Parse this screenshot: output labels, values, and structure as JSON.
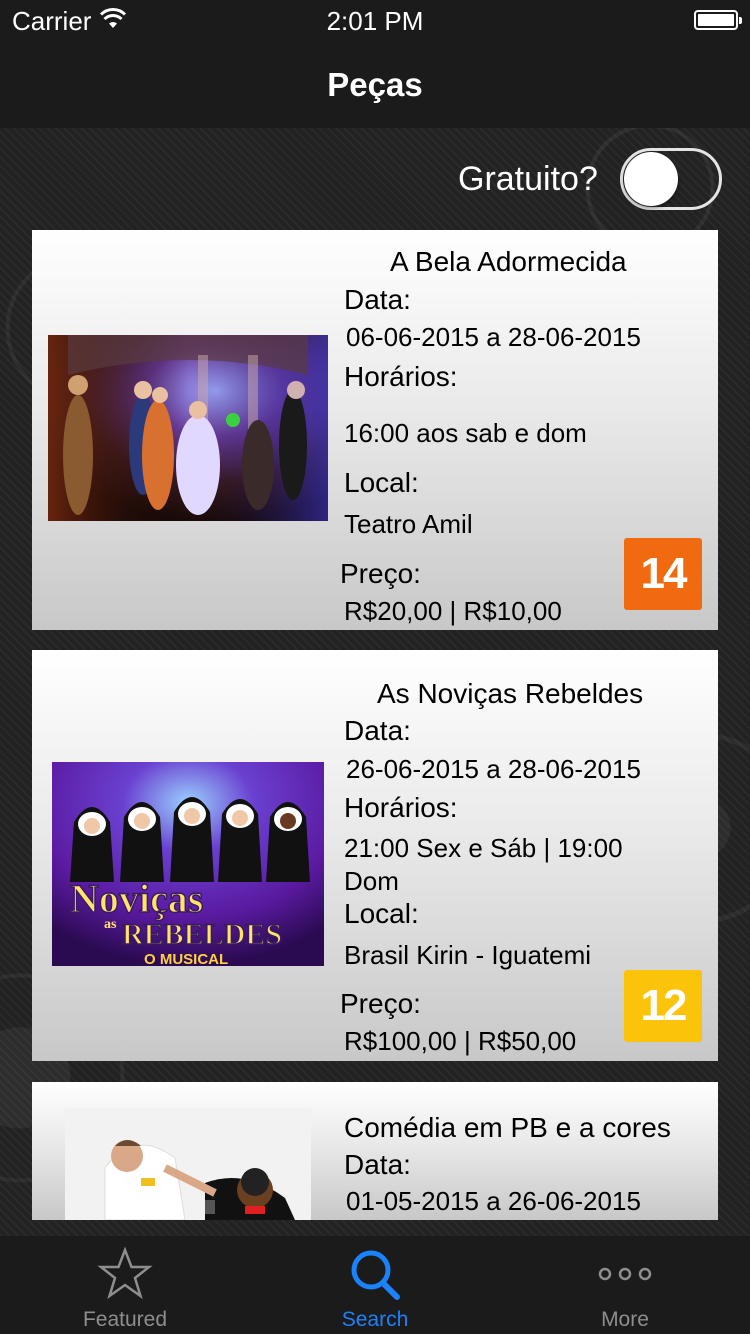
{
  "status_bar": {
    "carrier": "Carrier",
    "time": "2:01 PM"
  },
  "nav": {
    "title": "Peças"
  },
  "filter": {
    "label": "Gratuito?",
    "free_only": false
  },
  "plays": [
    {
      "title": "A Bela Adormecida",
      "date_label": "Data:",
      "dates": "06-06-2015 a 28-06-2015",
      "times_label": "Horários:",
      "times": "16:00 aos sab e dom",
      "venue_label": "Local:",
      "venue": "Teatro Amil",
      "price_label": "Preço:",
      "price": "R$20,00 | R$10,00",
      "rating": "14",
      "rating_color": "#f26a0f"
    },
    {
      "title": "As Noviças Rebeldes",
      "date_label": "Data:",
      "dates": "26-06-2015 a 28-06-2015",
      "times_label": "Horários:",
      "times_line1": "21:00 Sex e Sáb | 19:00",
      "times_line2": "Dom",
      "venue_label": "Local:",
      "venue": "Brasil Kirin - Iguatemi",
      "price_label": "Preço:",
      "price": "R$100,00 | R$50,00",
      "rating": "12",
      "rating_color": "#fcc30b",
      "poster_text_line1": "Noviças",
      "poster_text_small": "as",
      "poster_text_line2": "REBELDES",
      "poster_text_line3": "O MUSICAL"
    },
    {
      "title": "Comédia em PB e a cores",
      "date_label": "Data:",
      "dates": "01-05-2015 a 26-06-2015"
    }
  ],
  "tabs": [
    {
      "label": "Featured",
      "icon": "star-icon",
      "active": false
    },
    {
      "label": "Search",
      "icon": "search-icon",
      "active": true
    },
    {
      "label": "More",
      "icon": "more-icon",
      "active": false
    }
  ],
  "colors": {
    "accent": "#1a82fb",
    "inactive_tab": "#8e8e8e",
    "bar": "#1b1b1b"
  }
}
